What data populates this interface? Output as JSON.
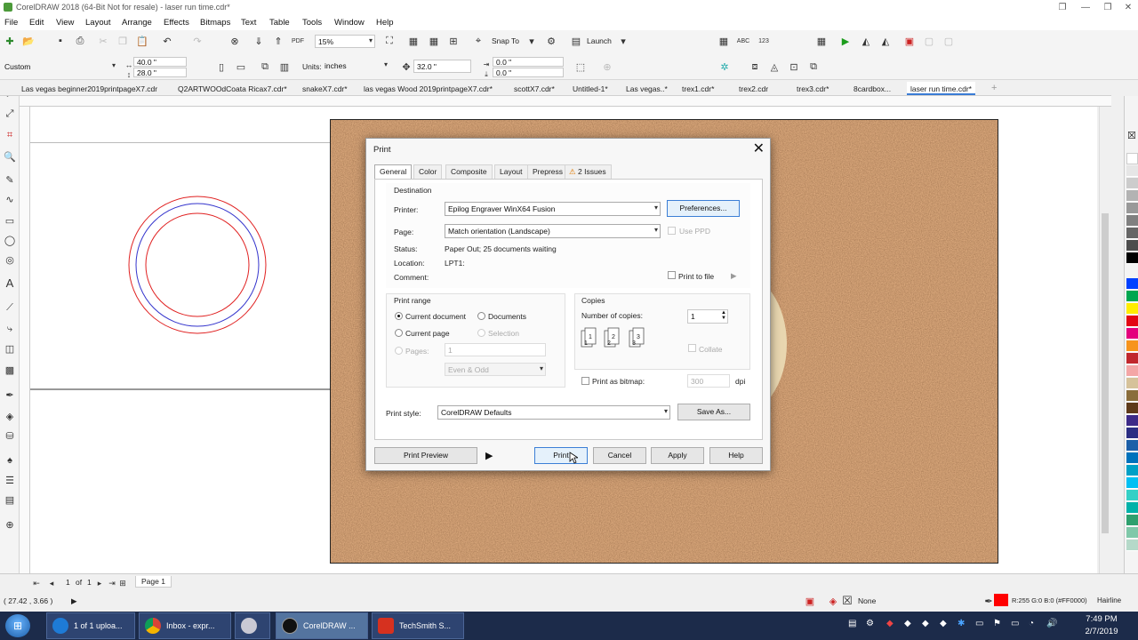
{
  "window": {
    "title": "CorelDRAW 2018 (64-Bit Not for resale) - laser run time.cdr*"
  },
  "menu": [
    "File",
    "Edit",
    "View",
    "Layout",
    "Arrange",
    "Effects",
    "Bitmaps",
    "Text",
    "Table",
    "Tools",
    "Window",
    "Help"
  ],
  "toolbar": {
    "zoom": "15%",
    "snap_to": "Snap To",
    "launch": "Launch",
    "page_preset": "Custom",
    "width": "40.0 \"",
    "height": "28.0 \"",
    "units_label": "Units:",
    "units": "inches",
    "nudge": "32.0 \"",
    "dup_x": "0.0 \"",
    "dup_y": "0.0 \""
  },
  "doc_tabs": [
    "Las vegas beginner2019printpageX7.cdr",
    "Q2ARTWOOdCoata Ricax7.cdr*",
    "snakeX7.cdr*",
    "las vegas Wood 2019printpageX7.cdr*",
    "scottX7.cdr*",
    "Untitled-1*",
    "Las vegas..*",
    "trex1.cdr*",
    "trex2.cdr",
    "trex3.cdr*",
    "8cardbox...",
    "laser run time.cdr*"
  ],
  "active_tab": "laser run time.cdr*",
  "dialog": {
    "title": "Print",
    "tabs": [
      "General",
      "Color",
      "Composite",
      "Layout",
      "Prepress",
      "2 Issues"
    ],
    "destination_label": "Destination",
    "printer_label": "Printer:",
    "printer": "Epilog Engraver WinX64 Fusion",
    "preferences_btn": "Preferences...",
    "page_label": "Page:",
    "page": "Match orientation (Landscape)",
    "use_ppd": "Use PPD",
    "status_label": "Status:",
    "status": "Paper Out; 25 documents waiting",
    "location_label": "Location:",
    "location": "LPT1:",
    "comment_label": "Comment:",
    "print_to_file": "Print to file",
    "print_range_label": "Print range",
    "current_document": "Current document",
    "documents": "Documents",
    "current_page": "Current page",
    "selection": "Selection",
    "pages_label": "Pages:",
    "pages_value": "1",
    "even_odd": "Even & Odd",
    "copies_label": "Copies",
    "num_copies_label": "Number of copies:",
    "num_copies": "1",
    "collate": "Collate",
    "print_as_bitmap": "Print as bitmap:",
    "dpi_value": "300",
    "dpi_label": "dpi",
    "print_style_label": "Print style:",
    "print_style": "CorelDRAW Defaults",
    "save_as_btn": "Save As...",
    "print_preview_btn": "Print Preview",
    "print_btn": "Print",
    "cancel_btn": "Cancel",
    "apply_btn": "Apply",
    "help_btn": "Help"
  },
  "pager": {
    "current": "1",
    "of": "of",
    "total": "1",
    "page_tab": "Page 1"
  },
  "status": {
    "coords": "( 27.42 , 3.66 )",
    "fill_none": "None",
    "outline_info": "R:255 G:0 B:0 (#FF0000)",
    "outline_width": "Hairline"
  },
  "taskbar": {
    "items": [
      "1 of 1 uploa...",
      "Inbox - expr...",
      "",
      "CorelDRAW ...",
      "TechSmith S..."
    ],
    "time": "7:49 PM",
    "date": "2/7/2019"
  },
  "colors": {
    "accent_outline": "#FF0000",
    "inner_circle": "#3333cc",
    "taskbar": "#1c2b4a"
  }
}
